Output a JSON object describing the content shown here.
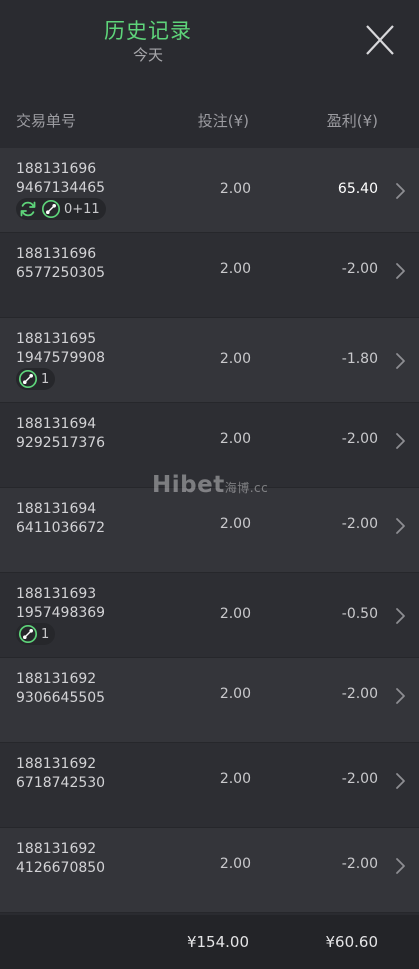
{
  "header": {
    "title": "历史记录",
    "subtitle": "今天"
  },
  "columns": {
    "bet_id": "交易单号",
    "stake": "投注(¥)",
    "profit": "盈利(¥)"
  },
  "rows": [
    {
      "id_line1": "188131696",
      "id_line2": "9467134465",
      "stake": "2.00",
      "profit": "65.40",
      "win": true,
      "icons": [
        "refresh-icon",
        "parlay-icon"
      ],
      "tag_text": "0+11"
    },
    {
      "id_line1": "188131696",
      "id_line2": "6577250305",
      "stake": "2.00",
      "profit": "-2.00",
      "win": false,
      "icons": [],
      "tag_text": ""
    },
    {
      "id_line1": "188131695",
      "id_line2": "1947579908",
      "stake": "2.00",
      "profit": "-1.80",
      "win": false,
      "icons": [
        "parlay-icon"
      ],
      "tag_text": "1"
    },
    {
      "id_line1": "188131694",
      "id_line2": "9292517376",
      "stake": "2.00",
      "profit": "-2.00",
      "win": false,
      "icons": [],
      "tag_text": ""
    },
    {
      "id_line1": "188131694",
      "id_line2": "6411036672",
      "stake": "2.00",
      "profit": "-2.00",
      "win": false,
      "icons": [],
      "tag_text": ""
    },
    {
      "id_line1": "188131693",
      "id_line2": "1957498369",
      "stake": "2.00",
      "profit": "-0.50",
      "win": false,
      "icons": [
        "parlay-icon"
      ],
      "tag_text": "1"
    },
    {
      "id_line1": "188131692",
      "id_line2": "9306645505",
      "stake": "2.00",
      "profit": "-2.00",
      "win": false,
      "icons": [],
      "tag_text": ""
    },
    {
      "id_line1": "188131692",
      "id_line2": "6718742530",
      "stake": "2.00",
      "profit": "-2.00",
      "win": false,
      "icons": [],
      "tag_text": ""
    },
    {
      "id_line1": "188131692",
      "id_line2": "4126670850",
      "stake": "2.00",
      "profit": "-2.00",
      "win": false,
      "icons": [],
      "tag_text": ""
    }
  ],
  "footer": {
    "total_stake": "¥154.00",
    "total_profit": "¥60.60"
  },
  "watermark": {
    "brand": "Hibet",
    "suffix": ".cc",
    "cn": "海博"
  },
  "colors": {
    "accent": "#5ed47a",
    "win_text": "#ffffff",
    "row_odd": "#34353a",
    "row_even": "#2d2e33"
  }
}
